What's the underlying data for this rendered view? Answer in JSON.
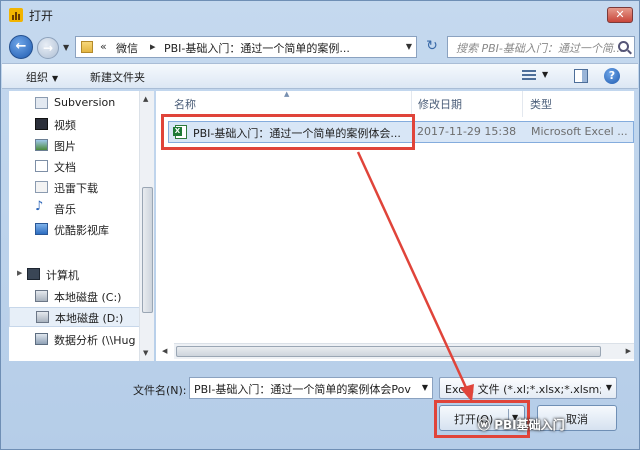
{
  "window": {
    "title": "打开",
    "close_glyph": "✕"
  },
  "nav": {
    "back_glyph": "←",
    "forward_glyph": "→",
    "address_overflow": "«",
    "address_parts": [
      "微信",
      "PBI-基础入门：通过一个简单的案例..."
    ],
    "refresh_glyph": "↻",
    "search_placeholder": "搜索 PBI-基础入门：通过一个简..."
  },
  "toolbar": {
    "organize_label": "组织",
    "new_folder_label": "新建文件夹",
    "help_glyph": "?"
  },
  "sidebar": {
    "items": [
      {
        "label": "Subversion",
        "icon": "subversion-icon"
      },
      {
        "label": "视频",
        "icon": "video-icon"
      },
      {
        "label": "图片",
        "icon": "picture-icon"
      },
      {
        "label": "文档",
        "icon": "document-icon"
      },
      {
        "label": "迅雷下载",
        "icon": "thunder-download-icon"
      },
      {
        "label": "音乐",
        "icon": "music-icon"
      },
      {
        "label": "优酷影视库",
        "icon": "youku-icon"
      }
    ],
    "computer_label": "计算机",
    "drives": [
      {
        "label": "本地磁盘 (C:)",
        "icon": "drive-c-icon",
        "selected": false
      },
      {
        "label": "本地磁盘 (D:)",
        "icon": "drive-d-icon",
        "selected": true
      },
      {
        "label": "数据分析 (\\\\Hug",
        "icon": "network-drive-icon",
        "selected": false
      }
    ]
  },
  "filelist": {
    "columns": [
      "名称",
      "修改日期",
      "类型"
    ],
    "rows": [
      {
        "name": "PBI-基础入门：通过一个简单的案例体会...",
        "modified": "2017-11-29 15:38",
        "type": "Microsoft Excel ..."
      }
    ]
  },
  "footer": {
    "filename_label": "文件名(N):",
    "filename_value": "PBI-基础入门：通过一个简单的案例体会Pov",
    "filter_value": "Excel 文件 (*.xl;*.xlsx;*.xlsm;*.x",
    "open_label": "打开(O)",
    "cancel_label": "取消"
  },
  "watermark": {
    "text": "PBI基础入门"
  },
  "colors": {
    "annotation_red": "#e0443a",
    "selection_blue": "#d8e6f6",
    "excel_green": "#1f7a36"
  }
}
